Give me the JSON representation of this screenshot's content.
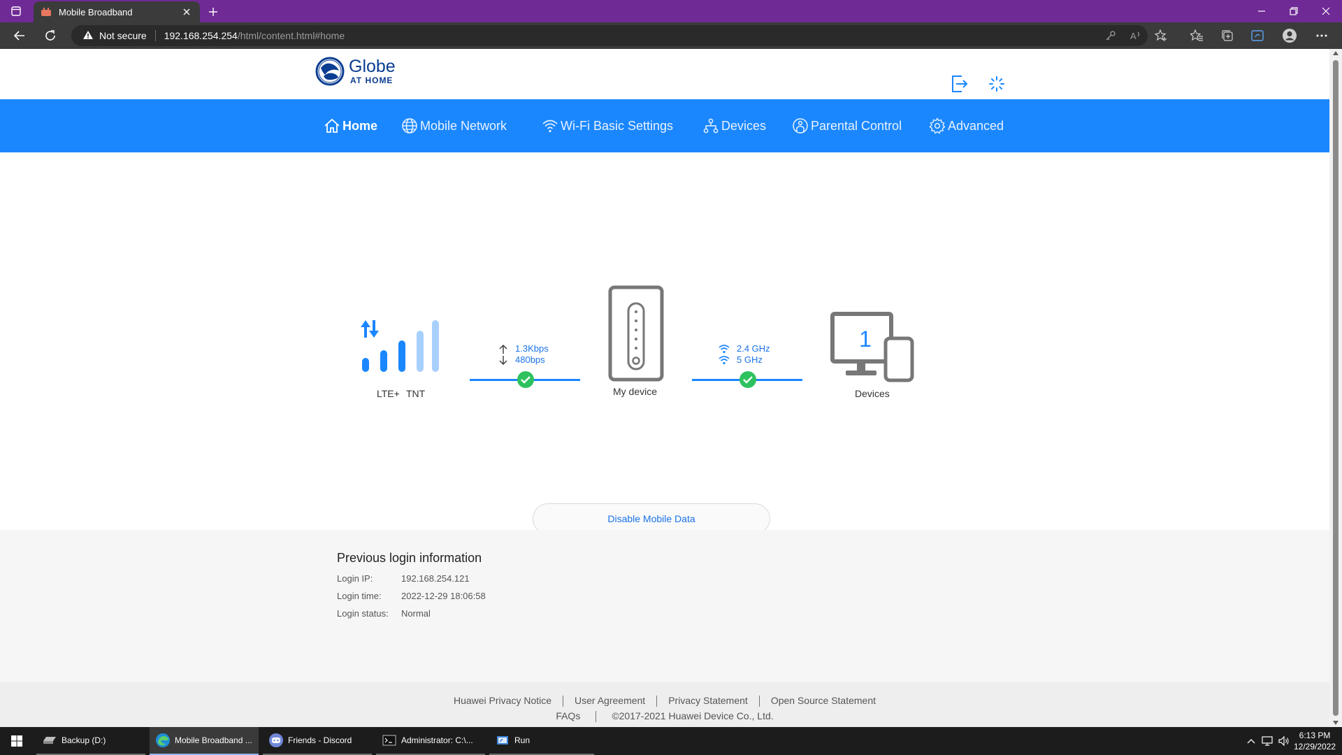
{
  "browser": {
    "tab_title": "Mobile Broadband",
    "security_label": "Not secure",
    "url_host": "192.168.254.254",
    "url_path": "/html/content.html#home"
  },
  "header": {
    "logo_brand": "Globe",
    "logo_sub": "AT HOME"
  },
  "menu": {
    "items": [
      {
        "label": "Home",
        "icon": "home-icon",
        "active": true
      },
      {
        "label": "Mobile Network",
        "icon": "globe-icon"
      },
      {
        "label": "Wi-Fi Basic Settings",
        "icon": "wifi-icon"
      },
      {
        "label": "Devices",
        "icon": "network-icon"
      },
      {
        "label": "Parental Control",
        "icon": "parental-icon"
      },
      {
        "label": "Advanced",
        "icon": "gear-icon"
      }
    ]
  },
  "status": {
    "network_type": "LTE+",
    "carrier": "TNT",
    "upload_speed": "1.3Kbps",
    "download_speed": "480bps",
    "device_label": "My device",
    "band_1": "2.4 GHz",
    "band_2": "5 GHz",
    "devices_count": "1",
    "devices_label": "Devices",
    "disable_button": "Disable Mobile Data"
  },
  "login": {
    "title": "Previous login information",
    "ip_label": "Login IP:",
    "ip_value": "192.168.254.121",
    "time_label": "Login time:",
    "time_value": "2022-12-29 18:06:58",
    "status_label": "Login status:",
    "status_value": "Normal"
  },
  "footer": {
    "links": [
      "Huawei Privacy Notice",
      "User Agreement",
      "Privacy Statement",
      "Open Source Statement"
    ],
    "faqs": "FAQs",
    "copyright": "©2017-2021 Huawei Device Co., Ltd."
  },
  "taskbar": {
    "items": [
      "Backup (D:)",
      "Mobile Broadband ...",
      "Friends - Discord",
      "Administrator: C:\\...",
      "Run"
    ],
    "time": "6:13 PM",
    "date": "12/29/2022"
  },
  "colors": {
    "titlebar": "#6f2a95",
    "menubar": "#1a87ff",
    "accent_text": "#1a73e8",
    "check_green": "#2ec25f",
    "logo_navy": "#0b3d91"
  }
}
